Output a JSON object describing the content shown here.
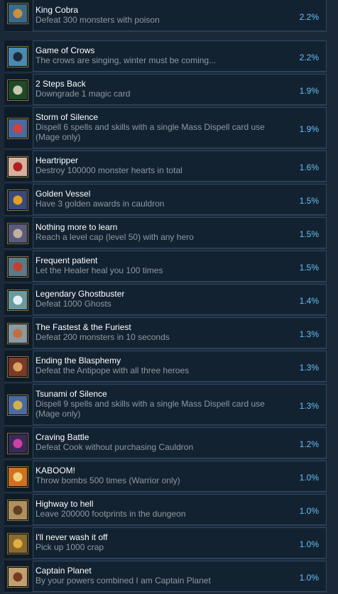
{
  "achievements": [
    {
      "title": "King Cobra",
      "description": "Defeat 300 monsters with poison",
      "percent": "2.2%",
      "icon": "poison-dagger-icon",
      "bg": "#3a6a8a",
      "fg": "#c89040"
    },
    {
      "title": "Game of Crows",
      "description": "The crows are singing, winter must be coming...",
      "percent": "2.2%",
      "icon": "crow-icon",
      "bg": "#4a8ab0",
      "fg": "#1a2a3a"
    },
    {
      "title": "2 Steps Back",
      "description": "Downgrade 1 magic card",
      "percent": "1.9%",
      "icon": "card-down-icon",
      "bg": "#1f4a2a",
      "fg": "#c8c8b0"
    },
    {
      "title": "Storm of Silence",
      "description": "Dispell 6 spells and skills with a single Mass Dispell card use (Mage only)",
      "percent": "1.9%",
      "icon": "mage-orb-icon",
      "bg": "#4a6aa0",
      "fg": "#d04040"
    },
    {
      "title": "Heartripper",
      "description": "Destroy 100000 monster hearts in total",
      "percent": "1.6%",
      "icon": "broken-heart-icon",
      "bg": "#d8b0a0",
      "fg": "#b02020"
    },
    {
      "title": "Golden Vessel",
      "description": "Have 3 golden awards in cauldron",
      "percent": "1.5%",
      "icon": "golden-vessel-icon",
      "bg": "#3a4a7a",
      "fg": "#e0a020"
    },
    {
      "title": "Nothing more to learn",
      "description": "Reach a level cap (level 50) with any hero",
      "percent": "1.5%",
      "icon": "book-icon",
      "bg": "#5a5a7a",
      "fg": "#c0b0a0"
    },
    {
      "title": "Frequent patient",
      "description": "Let the Healer heal you 100 times",
      "percent": "1.5%",
      "icon": "healer-icon",
      "bg": "#5a7a8a",
      "fg": "#c04030"
    },
    {
      "title": "Legendary Ghostbuster",
      "description": "Defeat 1000 Ghosts",
      "percent": "1.4%",
      "icon": "ghost-icon",
      "bg": "#6a9aa0",
      "fg": "#e0f0f0"
    },
    {
      "title": "The Fastest & the Furiest",
      "description": "Defeat 200 monsters in 10 seconds",
      "percent": "1.3%",
      "icon": "speed-icon",
      "bg": "#8a9aa0",
      "fg": "#c07040"
    },
    {
      "title": "Ending the Blasphemy",
      "description": "Defeat the Antipope with all three heroes",
      "percent": "1.3%",
      "icon": "antipope-icon",
      "bg": "#7a3a2a",
      "fg": "#e0a060"
    },
    {
      "title": "Tsunami of Silence",
      "description": "Dispell 9 spells and skills with a single Mass Dispell card use (Mage only)",
      "percent": "1.3%",
      "icon": "mage-wave-icon",
      "bg": "#4a6aa0",
      "fg": "#d0b050"
    },
    {
      "title": "Craving Battle",
      "description": "Defeat Cook without purchasing Cauldron",
      "percent": "1.2%",
      "icon": "cauldron-icon",
      "bg": "#3a2a5a",
      "fg": "#d040a0"
    },
    {
      "title": "KABOOM!",
      "description": "Throw bombs 500 times (Warrior only)",
      "percent": "1.0%",
      "icon": "explosion-icon",
      "bg": "#d07020",
      "fg": "#f0d080"
    },
    {
      "title": "Highway to hell",
      "description": "Leave 200000 footprints in the dungeon",
      "percent": "1.0%",
      "icon": "boot-icon",
      "bg": "#b09060",
      "fg": "#604020"
    },
    {
      "title": "I'll never wash it off",
      "description": "Pick up 1000 crap",
      "percent": "1.0%",
      "icon": "dirty-hand-icon",
      "bg": "#8a6a30",
      "fg": "#e0b040"
    },
    {
      "title": "Captain Planet",
      "description": "By your powers combined I am Captain Planet",
      "percent": "1.0%",
      "icon": "planet-icon",
      "bg": "#c0a070",
      "fg": "#7a3a20"
    }
  ]
}
